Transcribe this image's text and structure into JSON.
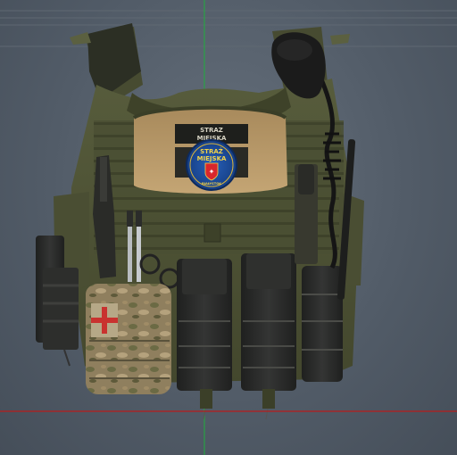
{
  "viewport": {
    "background": "#525c68",
    "grid_color": "#5c6670",
    "axis_x_color": "#b81c1c",
    "axis_y_color": "#1fae3c"
  },
  "vest": {
    "base_color": "#4d5235",
    "shade_color": "#3a3e27",
    "pouch_color": "#2a2b2a",
    "camo_base": "#8a7a5c",
    "name_tape_line1": "STRAZ",
    "name_tape_line2": "MIEJSKA",
    "badge_line1": "STRAŻ",
    "badge_line2": "MIEJSKA",
    "badge_line3": "BIAŁYSTOK",
    "badge_color": "#1b4fa0",
    "badge_accent": "#d9b43a",
    "badge_emblem_color": "#d8262c"
  }
}
